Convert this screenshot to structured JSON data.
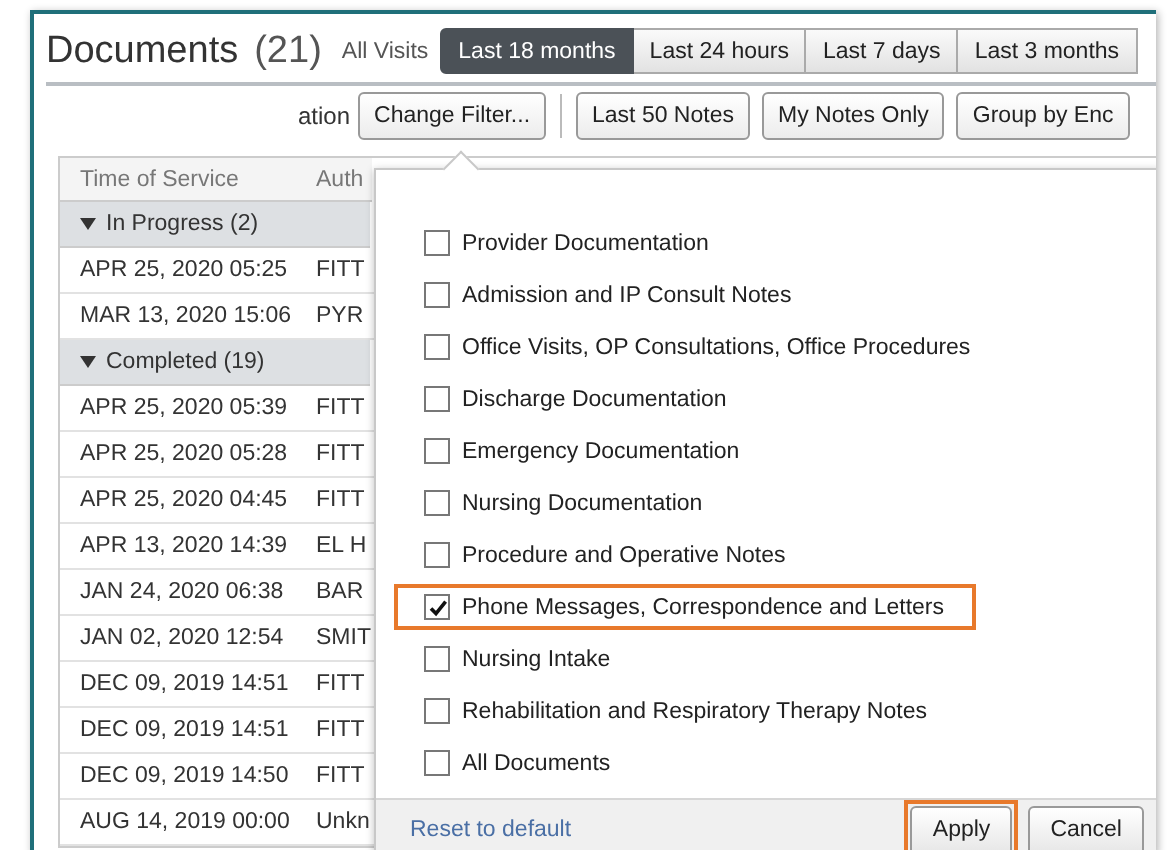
{
  "header": {
    "title": "Documents",
    "count": "(21)",
    "scope": "All Visits"
  },
  "tabs": [
    {
      "label": "Last 18 months",
      "selected": true
    },
    {
      "label": "Last 24 hours",
      "selected": false
    },
    {
      "label": "Last 7 days",
      "selected": false
    },
    {
      "label": "Last 3 months",
      "selected": false
    }
  ],
  "toolbar": {
    "cut_label": "ation",
    "buttons": [
      "Change Filter...",
      "Last 50 Notes",
      "My Notes Only",
      "Group by Enc"
    ]
  },
  "table": {
    "columns": [
      "Time of Service",
      "Auth"
    ],
    "rows": [
      {
        "kind": "group",
        "label": "In Progress (2)",
        "expanded": true
      },
      {
        "kind": "row",
        "cells": [
          "APR 25, 2020 05:25",
          "FITT"
        ]
      },
      {
        "kind": "row",
        "cells": [
          "MAR 13, 2020 15:06",
          "PYR"
        ]
      },
      {
        "kind": "group",
        "label": "Completed (19)",
        "expanded": true
      },
      {
        "kind": "row",
        "cells": [
          "APR 25, 2020 05:39",
          "FITT"
        ]
      },
      {
        "kind": "row",
        "cells": [
          "APR 25, 2020 05:28",
          "FITT"
        ]
      },
      {
        "kind": "row",
        "cells": [
          "APR 25, 2020 04:45",
          "FITT"
        ]
      },
      {
        "kind": "row",
        "cells": [
          "APR 13, 2020 14:39",
          "EL H"
        ]
      },
      {
        "kind": "row",
        "cells": [
          "JAN 24, 2020 06:38",
          "BAR"
        ]
      },
      {
        "kind": "row",
        "cells": [
          "JAN 02, 2020 12:54",
          "SMIT"
        ]
      },
      {
        "kind": "row",
        "cells": [
          "DEC 09, 2019 14:51",
          "FITT"
        ]
      },
      {
        "kind": "row",
        "cells": [
          "DEC 09, 2019 14:51",
          "FITT"
        ]
      },
      {
        "kind": "row",
        "cells": [
          "DEC 09, 2019 14:50",
          "FITT"
        ]
      },
      {
        "kind": "row",
        "cells": [
          "AUG 14, 2019 00:00",
          "Unkn"
        ]
      }
    ]
  },
  "filter_popup": {
    "options": [
      {
        "label": "Provider Documentation",
        "checked": false,
        "highlighted": false
      },
      {
        "label": "Admission and IP Consult Notes",
        "checked": false,
        "highlighted": false
      },
      {
        "label": "Office Visits, OP Consultations, Office Procedures",
        "checked": false,
        "highlighted": false
      },
      {
        "label": "Discharge Documentation",
        "checked": false,
        "highlighted": false
      },
      {
        "label": "Emergency Documentation",
        "checked": false,
        "highlighted": false
      },
      {
        "label": "Nursing Documentation",
        "checked": false,
        "highlighted": false
      },
      {
        "label": "Procedure and Operative Notes",
        "checked": false,
        "highlighted": false
      },
      {
        "label": "Phone Messages, Correspondence and Letters",
        "checked": true,
        "highlighted": true
      },
      {
        "label": "Nursing Intake",
        "checked": false,
        "highlighted": false
      },
      {
        "label": "Rehabilitation and Respiratory Therapy Notes",
        "checked": false,
        "highlighted": false
      },
      {
        "label": "All Documents",
        "checked": false,
        "highlighted": false
      }
    ],
    "reset_link": "Reset to default",
    "buttons": [
      {
        "label": "Apply",
        "highlighted": true
      },
      {
        "label": "Cancel",
        "highlighted": false
      }
    ]
  }
}
